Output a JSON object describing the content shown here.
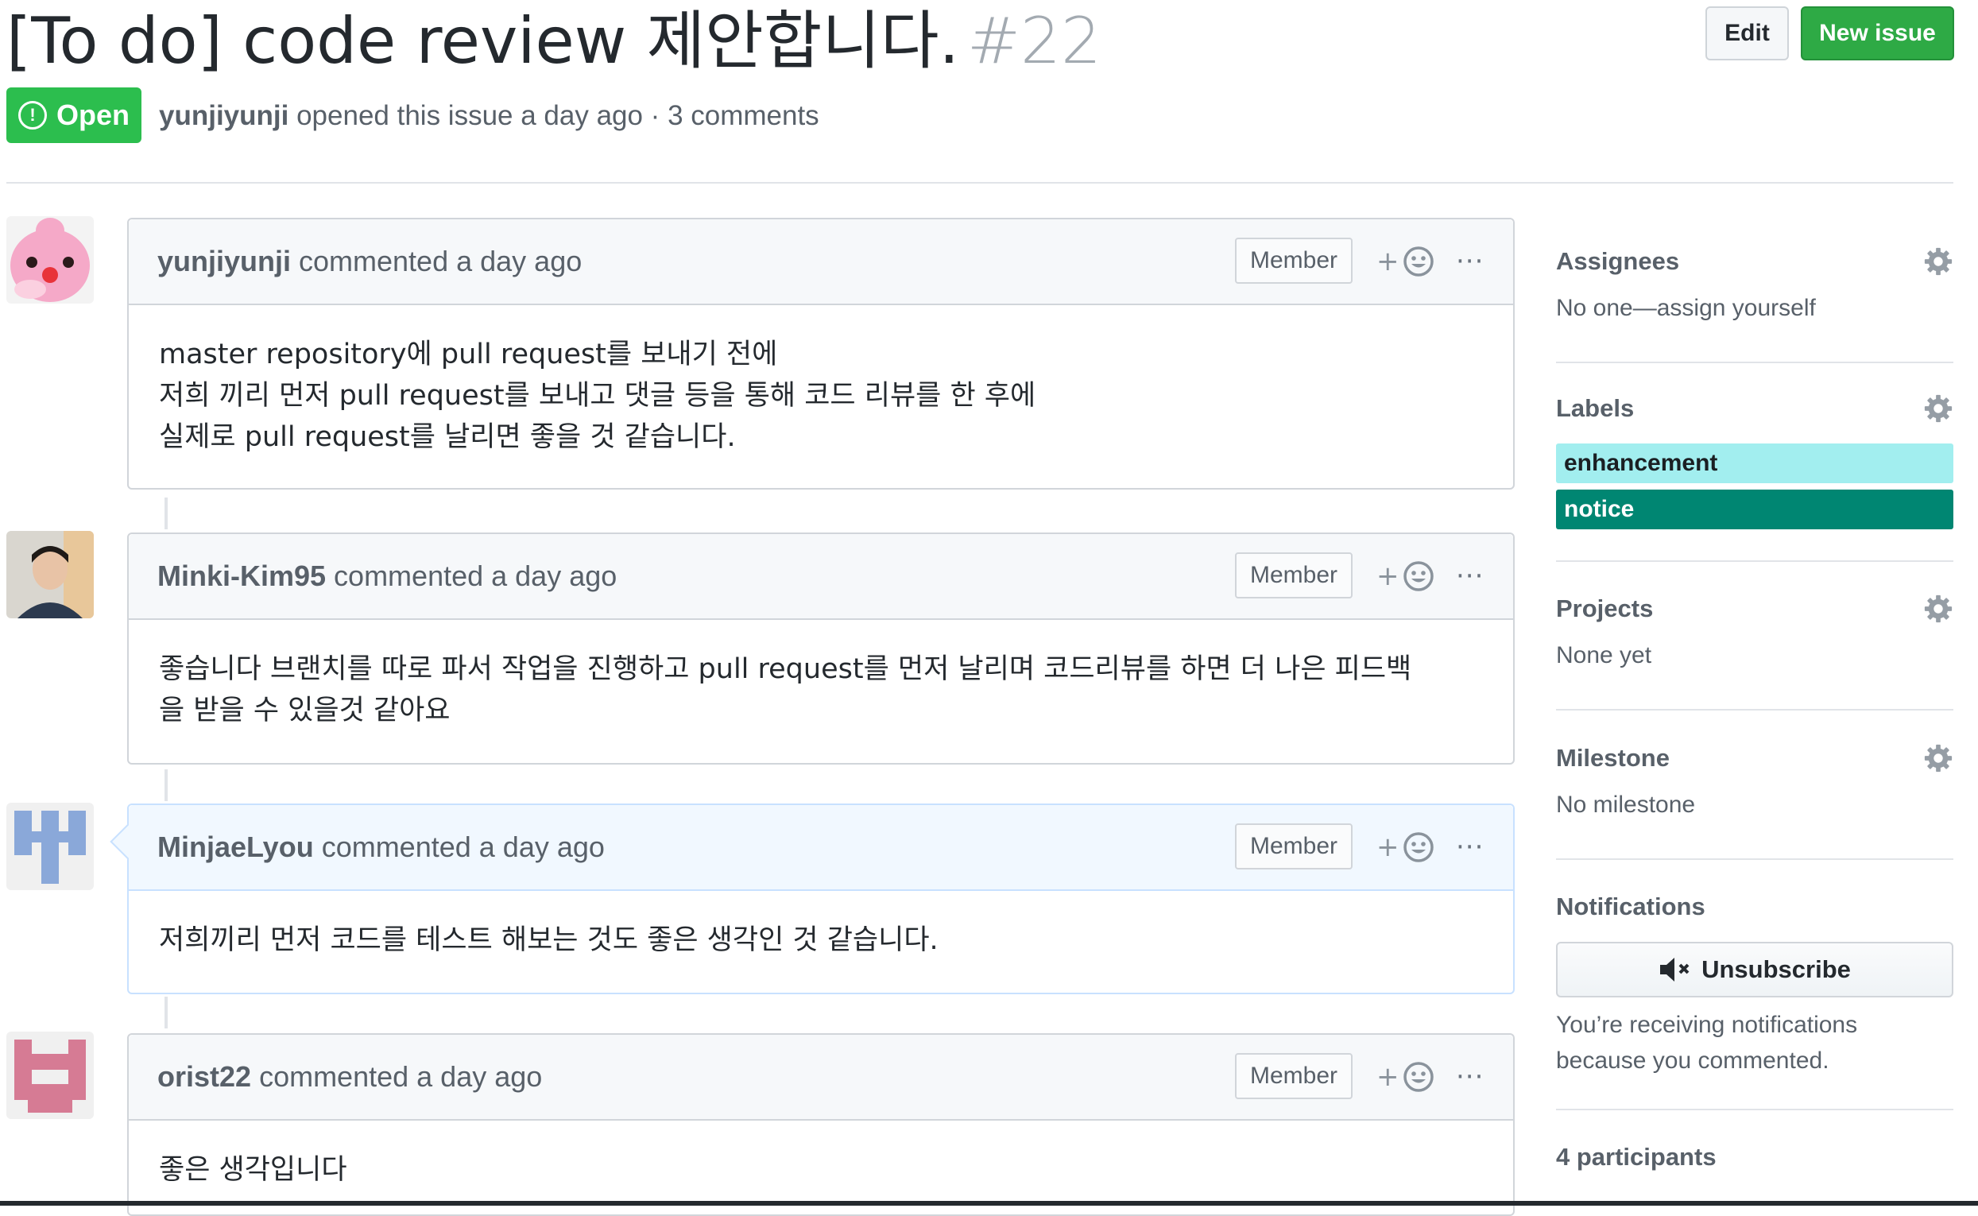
{
  "header": {
    "title": "[To do] code review 제안합니다.",
    "number": "#22",
    "edit_label": "Edit",
    "new_issue_label": "New issue",
    "state": "Open",
    "state_icon": "!",
    "author": "yunjiyunji",
    "meta_text": " opened this issue a day ago · 3 comments"
  },
  "comments": [
    {
      "author": "yunjiyunji",
      "action": "commented a day ago",
      "role": "Member",
      "body": "master repository에 pull request를 보내기 전에\n저희 끼리 먼저 pull request를 보내고 댓글 등을 통해 코드 리뷰를 한 후에\n실제로 pull request를 날리면 좋을 것 같습니다."
    },
    {
      "author": "Minki-Kim95",
      "action": "commented a day ago",
      "role": "Member",
      "body": "좋습니다 브랜치를 따로 파서 작업을 진행하고 pull request를 먼저 날리며 코드리뷰를 하면 더 나은 피드백\n을 받을 수 있을것 같아요"
    },
    {
      "author": "MinjaeLyou",
      "action": "commented a day ago",
      "role": "Member",
      "body": "저희끼리 먼저 코드를 테스트 해보는 것도 좋은 생각인 것 같습니다."
    },
    {
      "author": "orist22",
      "action": "commented a day ago",
      "role": "Member",
      "body": "좋은 생각입니다"
    }
  ],
  "reaction": {
    "plus": "+",
    "more": "···"
  },
  "sidebar": {
    "assignees": {
      "title": "Assignees",
      "value": "No one—assign yourself"
    },
    "labels": {
      "title": "Labels",
      "items": [
        {
          "name": "enhancement",
          "color": "#a2eeef",
          "text_color": "#1b1f23"
        },
        {
          "name": "notice",
          "color": "#008672",
          "text_color": "#ffffff"
        }
      ]
    },
    "projects": {
      "title": "Projects",
      "value": "None yet"
    },
    "milestone": {
      "title": "Milestone",
      "value": "No milestone"
    },
    "notifications": {
      "title": "Notifications",
      "button": "Unsubscribe",
      "note": "You’re receiving notifications because you commented."
    },
    "participants": {
      "title": "4 participants"
    }
  },
  "colors": {
    "open_green": "#2cbe4e",
    "new_issue_green": "#2eaa45",
    "enhancement": "#a2eeef",
    "notice": "#008672"
  },
  "icons": [
    "issue-opened-icon",
    "smiley-icon",
    "kebab-icon",
    "gear-icon",
    "mute-icon"
  ]
}
